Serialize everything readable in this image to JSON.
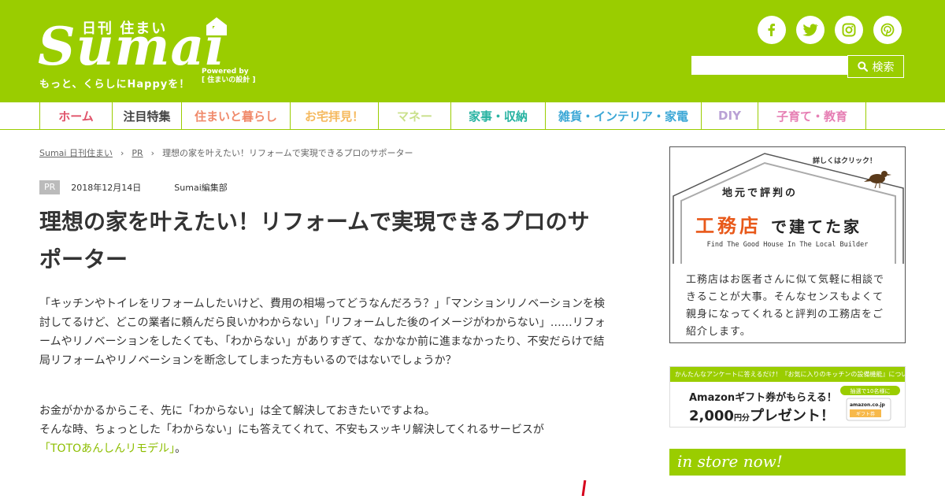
{
  "header": {
    "logo_small": "日刊 住まい",
    "logo_big": "Sumai",
    "logo_powered_1": "Powered by",
    "logo_powered_2": "[ 住まいの設計 ]",
    "logo_tagline": "もっと、くらしにHappyを！",
    "search_placeholder": "",
    "search_button_label": "検索",
    "social": [
      {
        "name": "facebook-icon",
        "glyph": "f"
      },
      {
        "name": "twitter-icon",
        "glyph": "t"
      },
      {
        "name": "instagram-icon",
        "glyph": "◎"
      },
      {
        "name": "pinterest-icon",
        "glyph": "p"
      }
    ],
    "colors": {
      "brand": "#9acd00"
    }
  },
  "nav": {
    "items": [
      {
        "label": "ホーム",
        "color": "#e0536a"
      },
      {
        "label": "注目特集",
        "color": "#444444"
      },
      {
        "label": "住まいと暮らし",
        "color": "#f08a6b"
      },
      {
        "label": "お宅拝見！",
        "color": "#f5b95e"
      },
      {
        "label": "マネー",
        "color": "#c9e08a"
      },
      {
        "label": "家事・収納",
        "color": "#29b3a2"
      },
      {
        "label": "雑貨・インテリア・家電",
        "color": "#3ba7d6"
      },
      {
        "label": "DIY",
        "color": "#b9a1d5"
      },
      {
        "label": "子育て・教育",
        "color": "#e67fb4"
      }
    ]
  },
  "breadcrumb": {
    "home": "Sumai 日刊住まい",
    "category": "PR",
    "current": "理想の家を叶えたい！リフォームで実現できるプロのサポーター"
  },
  "article": {
    "badge": "PR",
    "date": "2018年12月14日",
    "author": "Sumai編集部",
    "title": "理想の家を叶えたい！リフォームで実現できるプロのサポーター",
    "para1": "「キッチンやトイレをリフォームしたいけど、費用の相場ってどうなんだろう？」「マンションリノベーションを検討してるけど、どこの業者に頼んだら良いかわからない」「リフォームした後のイメージがわからない」……リフォームやリノベーションをしたくても、「わからない」がありすぎて、なかなか前に進まなかったり、不安だらけで結局リフォームやリノベーションを断念してしまった方もいるのではないでしょうか？",
    "para2_line1": "お金がかかるからこそ、先に「わからない」は全て解決しておきたいですよね。",
    "para2_line2": "そんな時、ちょっとした「わからない」にも答えてくれて、不安もスッキリ解決してくれるサービスが",
    "para2_link": "「TOTOあんしんリモデル」",
    "para2_end": "。"
  },
  "sidebar": {
    "ad1": {
      "click_label": "詳しくはクリック！",
      "heading_small": "地元で評判の",
      "heading_big_1": "工務店",
      "heading_big_2": "で建てた家",
      "heading_en": "Find The Good House In The Local Builder",
      "description": "工務店はお医者さんに似て気軽に相談できることが大事。そんなセンスもよくて親身になってくれると評判の工務店をご紹介します。"
    },
    "ad2": {
      "top": "かんたんなアンケートに答えるだけ！『お気に入りのキッチンの設備機能』について",
      "line1": "Amazonギフト券がもらえる！",
      "line2_amount": "2,000",
      "line2_unit": "円分",
      "line2_rest": "プレゼント！",
      "badge_top": "抽選で10名様に",
      "badge_amazon": "amazon.co.jp",
      "badge_gift": "ギフト券"
    },
    "store_label": "in store now!"
  }
}
